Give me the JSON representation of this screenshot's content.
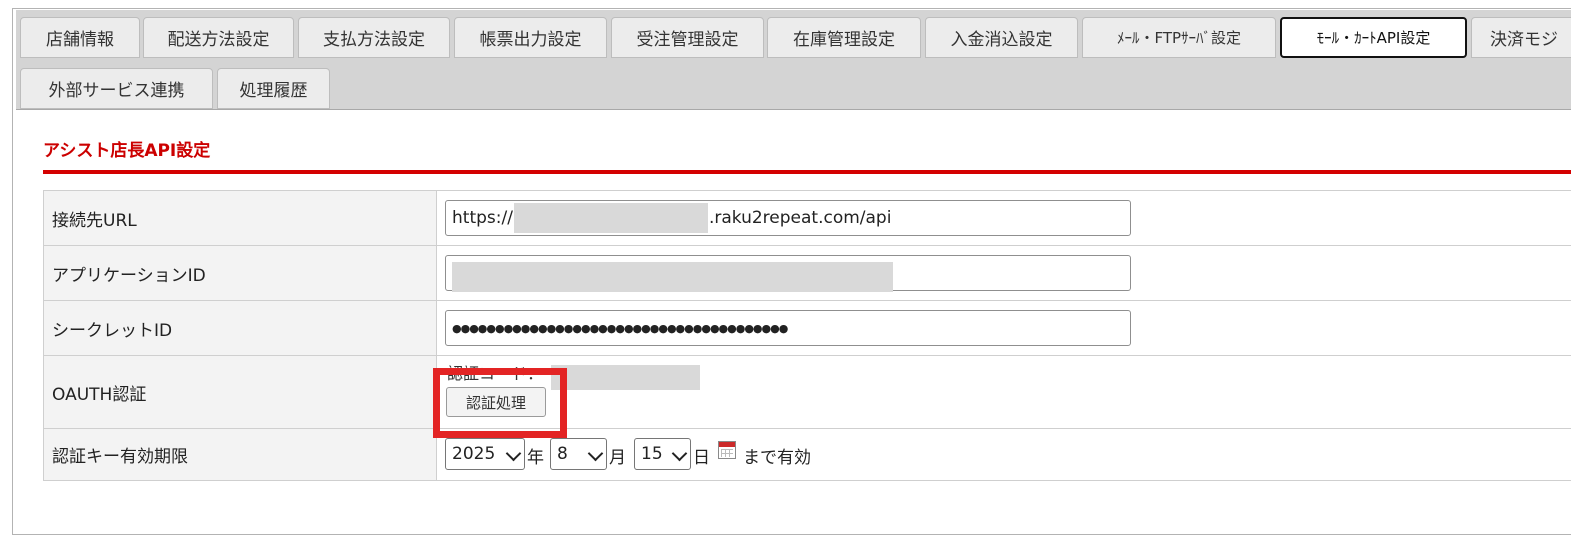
{
  "tabs": [
    {
      "label": "店舗情報"
    },
    {
      "label": "配送方法設定"
    },
    {
      "label": "支払方法設定"
    },
    {
      "label": "帳票出力設定"
    },
    {
      "label": "受注管理設定"
    },
    {
      "label": "在庫管理設定"
    },
    {
      "label": "入金消込設定"
    },
    {
      "label": "ﾒｰﾙ・FTPｻｰﾊﾞ設定"
    },
    {
      "label": "ﾓｰﾙ・ｶｰﾄAPI設定"
    },
    {
      "label": "決済モジ"
    },
    {
      "label": "外部サービス連携"
    },
    {
      "label": "処理履歴"
    }
  ],
  "active_tab": "ﾓｰﾙ・ｶｰﾄAPI設定",
  "section_title": "アシスト店長API設定",
  "rows": {
    "url": {
      "label": "接続先URL",
      "prefix": "https://",
      "suffix": ".raku2repeat.com/api"
    },
    "app_id": {
      "label": "アプリケーションID"
    },
    "secret": {
      "label": "シークレットID",
      "masked_value": "●●●●●●●●●●●●●●●●●●●●●●●●●●●●●●●●●●●●●●●"
    },
    "oauth": {
      "label": "OAUTH認証",
      "code_label": "認証コード：",
      "button_label": "認証処理"
    },
    "expiry": {
      "label": "認証キー有効期限",
      "year": "2025",
      "year_unit": "年",
      "month": "8",
      "month_unit": "月",
      "day": "15",
      "day_unit": "日",
      "suffix": "まで有効"
    }
  },
  "colors": {
    "accent_red": "#d40000",
    "highlight_red": "#e32424",
    "tabbar_bg": "#d4d4d4"
  },
  "icons": {
    "calendar": "calendar-icon",
    "dropdown": "chevron-down-icon"
  }
}
